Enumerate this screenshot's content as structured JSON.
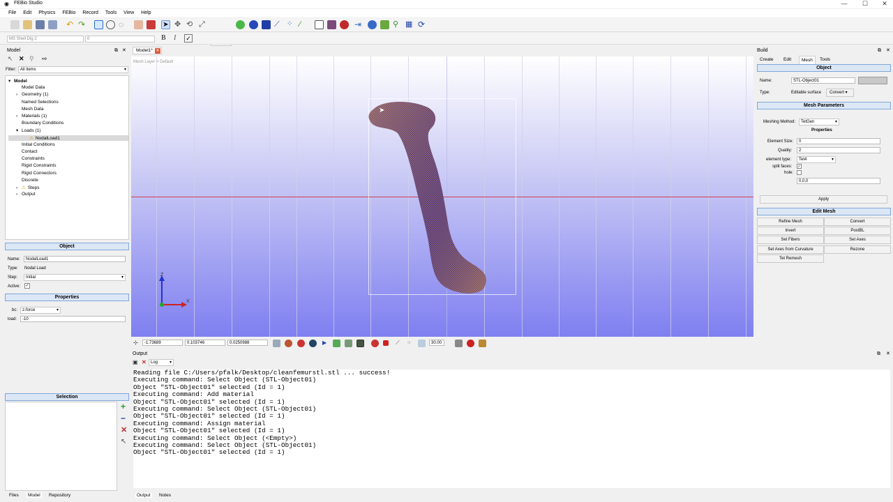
{
  "window": {
    "title": "FEBio Studio",
    "minimize": "—",
    "maximize": "☐",
    "close": "✕"
  },
  "menu": [
    "File",
    "Edit",
    "Physics",
    "FEBio",
    "Record",
    "Tools",
    "View",
    "Help"
  ],
  "toolbar2": {
    "font_combo": "MS Shell Dlg 2",
    "size_value": "0",
    "bold": "B",
    "italic": "I",
    "check": "✓"
  },
  "model_panel": {
    "title": "Model",
    "filter_label": "Filter:",
    "filter_value": "All items",
    "tree": [
      {
        "label": "Model",
        "indent": 0,
        "exp": "▾",
        "bold": true
      },
      {
        "label": "Model Data",
        "indent": 1,
        "exp": ""
      },
      {
        "label": "Geometry (1)",
        "indent": 1,
        "exp": "›"
      },
      {
        "label": "Named Selections",
        "indent": 1,
        "exp": ""
      },
      {
        "label": "Mesh Data",
        "indent": 1,
        "exp": ""
      },
      {
        "label": "Materials (1)",
        "indent": 1,
        "exp": "›"
      },
      {
        "label": "Boundary Conditions",
        "indent": 1,
        "exp": ""
      },
      {
        "label": "Loads (1)",
        "indent": 1,
        "exp": "▾"
      },
      {
        "label": "NodalLoad1",
        "indent": 2,
        "exp": "",
        "warn": true,
        "selected": true
      },
      {
        "label": "Initial Conditions",
        "indent": 1,
        "exp": ""
      },
      {
        "label": "Contact",
        "indent": 1,
        "exp": ""
      },
      {
        "label": "Constraints",
        "indent": 1,
        "exp": ""
      },
      {
        "label": "Rigid Constraints",
        "indent": 1,
        "exp": ""
      },
      {
        "label": "Rigid Connectors",
        "indent": 1,
        "exp": ""
      },
      {
        "label": "Discrete",
        "indent": 1,
        "exp": ""
      },
      {
        "label": "Steps",
        "indent": 1,
        "exp": "›",
        "warn": true
      },
      {
        "label": "Output",
        "indent": 1,
        "exp": "›"
      }
    ],
    "object": {
      "header": "Object",
      "name_label": "Name:",
      "name_value": "NodalLoad1",
      "type_label": "Type:",
      "type_value": "Nodal Load",
      "step_label": "Step:",
      "step_value": "Initial",
      "active_label": "Active:"
    },
    "properties": {
      "header": "Properties",
      "bc_label": "bc:",
      "bc_value": "z-force",
      "load_label": "load:",
      "load_value": "-10"
    },
    "selection": {
      "header": "Selection"
    },
    "bottom_tabs": [
      "Files",
      "Model",
      "Repository"
    ]
  },
  "viewport": {
    "tab": "Model1*",
    "breadcrumb": "Mesh Layer > Default",
    "axis_z": "Z",
    "axis_x": "X"
  },
  "viewport_toolbar": {
    "x": "-1.73689",
    "y": "0.103746",
    "z": "0.0250988",
    "zoom": "30.00"
  },
  "build_panel": {
    "title": "Build",
    "tabs": [
      "Create",
      "Edit",
      "Mesh",
      "Tools"
    ],
    "object_header": "Object",
    "name_label": "Name:",
    "name_value": "STL-Object01",
    "type_label": "Type:",
    "type_value": "Editable surface",
    "convert_label": "Convert",
    "mesh_params_header": "Mesh Parameters",
    "meshing_method_label": "Meshing Method:",
    "meshing_method_value": "TetGen",
    "properties_label": "Properties",
    "element_size_label": "Element Size:",
    "element_size_value": "0",
    "quality_label": "Quality:",
    "quality_value": "2",
    "element_type_label": "element type:",
    "element_type_value": "Tet4",
    "split_faces_label": "split faces:",
    "hole_label": "hole:",
    "hole_value": "0,0,0",
    "apply": "Apply",
    "edit_mesh_header": "Edit Mesh",
    "edit_buttons": [
      "Refine Mesh",
      "Convert",
      "Invert",
      "PostBL",
      "Set Fibers",
      "Set Axes",
      "Set Axes from Curvature",
      "Rezone",
      "Tet Remesh"
    ]
  },
  "output_panel": {
    "title": "Output",
    "log_combo": "Log",
    "lines": [
      "Reading file C:/Users/pfalk/Desktop/cleanfemurstl.stl ... success!",
      "Executing command: Select Object (STL-Object01)",
      "Object \"STL-Object01\" selected (Id = 1)",
      "Executing command: Add material",
      "Object \"STL-Object01\" selected (Id = 1)",
      "Executing command: Select Object (STL-Object01)",
      "Object \"STL-Object01\" selected (Id = 1)",
      "Executing command: Assign material",
      "Object \"STL-Object01\" selected (Id = 1)",
      "Executing command: Select Object (<Empty>)",
      "Executing command: Select Object (STL-Object01)",
      "Object \"STL-Object01\" selected (Id = 1)"
    ],
    "bottom_tabs": [
      "Output",
      "Notes"
    ]
  },
  "colors": {
    "accent_header": "#dce7f6",
    "mesh": "#5b3a8a",
    "viewport_bottom": "#7f7ff1"
  }
}
